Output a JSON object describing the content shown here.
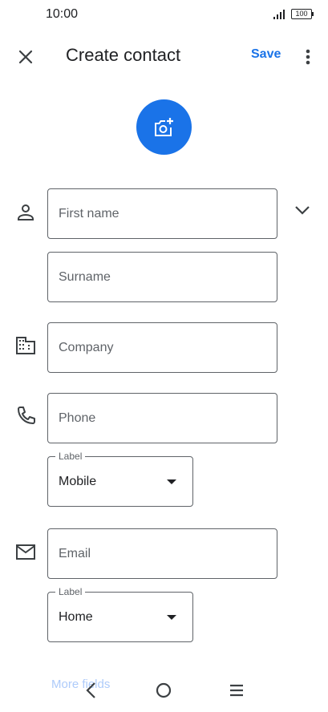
{
  "status_bar": {
    "time": "10:00",
    "battery": "100"
  },
  "app_bar": {
    "title": "Create contact",
    "save_label": "Save",
    "close_icon": "close-icon",
    "more_icon": "more-vert-icon"
  },
  "photo": {
    "icon": "add-photo-icon",
    "color": "#1a73e8"
  },
  "fields": {
    "first_name_placeholder": "First name",
    "surname_placeholder": "Surname",
    "company_placeholder": "Company",
    "phone_placeholder": "Phone",
    "phone_label_legend": "Label",
    "phone_label_value": "Mobile",
    "email_placeholder": "Email",
    "email_label_legend": "Label",
    "email_label_value": "Home"
  },
  "more_fields": "More fields",
  "colors": {
    "accent": "#1a73e8",
    "text": "#202124",
    "border": "#5f6368"
  }
}
